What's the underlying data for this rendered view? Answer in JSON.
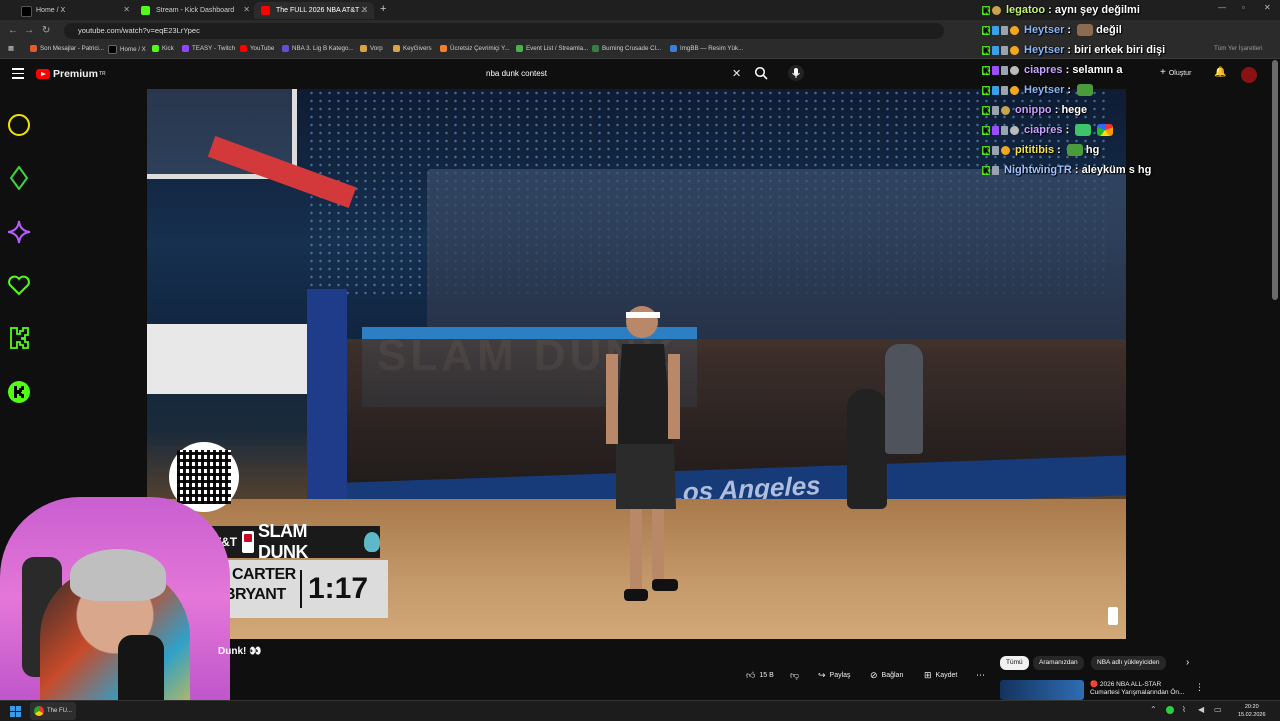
{
  "browser": {
    "tabs": [
      {
        "label": "Home / X",
        "color": "#000000"
      },
      {
        "label": "Stream - Kick Dashboard",
        "color": "#53fc18"
      },
      {
        "label": "The FULL 2026 NBA AT&T ...",
        "color": "#ff0000"
      }
    ],
    "new_tab": "+",
    "url": "youtube.com/watch?v=eqE23LrYpec",
    "bookmarks": [
      "Son Mesajlar - Patrici...",
      "Home / X",
      "Kick",
      "TEASY - Twitch",
      "YouTube",
      "NBA 3. Lig B Katego...",
      "Vorp",
      "KeyGivers",
      "Ücretsiz Çevrimiçi Y...",
      "Event List / Streamla...",
      "Burning Crusade Cl...",
      "ImgBB — Resim Yük..."
    ],
    "bookmarks_all": "Tüm Yer İşaretleri"
  },
  "youtube": {
    "logo_text": "Premium",
    "logo_sup": "TR",
    "search_value": "nba dunk contest",
    "create_label": "Oluştur",
    "video_title": "Dunk! 👀",
    "actions": {
      "likes": "15 B",
      "share": "Paylaş",
      "link": "Bağlan",
      "save": "Kaydet"
    },
    "chips": [
      "Tümü",
      "Aramanızdan",
      "NBA adlı yükleyiciden"
    ],
    "suggest": {
      "line1": "🔴 2026 NBA ALL-STAR",
      "line2": "Cumartesi Yarışmalarından Ön..."
    }
  },
  "overlay": {
    "scorebug": {
      "sponsor": "AT&T",
      "title": "SLAM DUNK",
      "name1": "CARTER",
      "name2": "BRYANT",
      "time": "1:17"
    },
    "court_text": "Los Angeles"
  },
  "chat": [
    {
      "user": "legatoo",
      "msg": "aynı şey değilmi",
      "color": "#c6f27a"
    },
    {
      "user": "Heytser",
      "msg": "değil",
      "color": "#8ab4f8"
    },
    {
      "user": "Heytser",
      "msg": "biri erkek biri dişi",
      "color": "#8ab4f8"
    },
    {
      "user": "ciapres",
      "msg": "selamın a",
      "color": "#c6a3ff"
    },
    {
      "user": "Heytser",
      "msg": "",
      "color": "#8ab4f8"
    },
    {
      "user": "onippo",
      "msg": "hege",
      "color": "#c89cff"
    },
    {
      "user": "ciapres",
      "msg": "",
      "color": "#c6a3ff"
    },
    {
      "user": "pititibis",
      "msg": "hg",
      "color": "#f4e24a"
    },
    {
      "user": "NightwingTR",
      "msg": "aleyküm s hg",
      "color": "#9fc2ff"
    }
  ],
  "taskbar": {
    "app": "The FU...",
    "time": "20:20",
    "date": "15.02.2026"
  },
  "colors": {
    "youtube_red": "#ff0000",
    "kick_green": "#53fc18",
    "webcam_pink": "#e477d8"
  }
}
